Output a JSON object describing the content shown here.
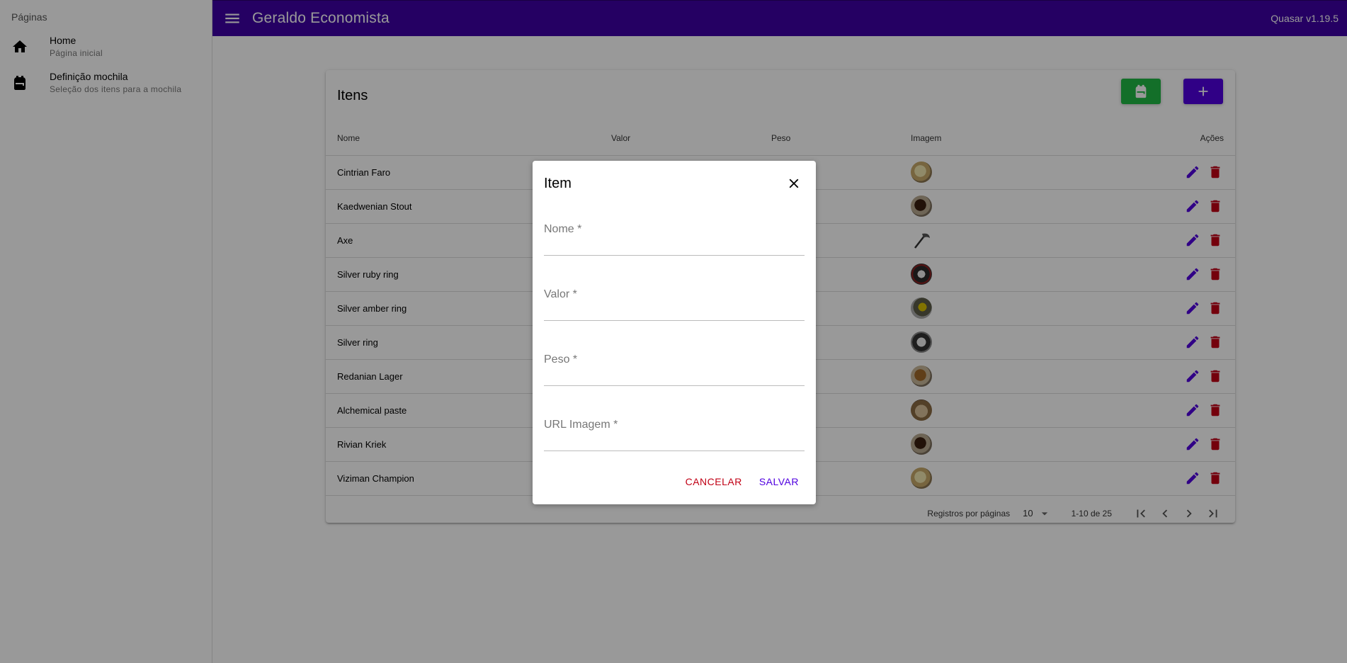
{
  "header": {
    "title": "Geraldo Economista",
    "version": "Quasar v1.19.5"
  },
  "sidebar": {
    "heading": "Páginas",
    "items": [
      {
        "label": "Home",
        "caption": "Página inicial",
        "icon": "home-icon"
      },
      {
        "label": "Definição mochila",
        "caption": "Seleção dos itens para a mochila",
        "icon": "backpack-icon"
      }
    ]
  },
  "card": {
    "title": "Itens",
    "columns": [
      "Nome",
      "Valor",
      "Peso",
      "Imagem",
      "Ações"
    ],
    "rows": [
      {
        "nome": "Cintrian Faro",
        "image": "mug-light"
      },
      {
        "nome": "Kaedwenian Stout",
        "image": "mug-dark"
      },
      {
        "nome": "Axe",
        "image": "axe"
      },
      {
        "nome": "Silver ruby ring",
        "image": "ring-ruby"
      },
      {
        "nome": "Silver amber ring",
        "image": "ring-amber"
      },
      {
        "nome": "Silver ring",
        "image": "ring-silver"
      },
      {
        "nome": "Redanian Lager",
        "image": "mug-amber"
      },
      {
        "nome": "Alchemical paste",
        "image": "pot"
      },
      {
        "nome": "Rivian Kriek",
        "image": "mug-dark"
      },
      {
        "nome": "Viziman Champion",
        "image": "mug-light"
      }
    ],
    "pagination": {
      "rows_label": "Registros por páginas",
      "rows_per_page": "10",
      "range": "1-10 de 25"
    }
  },
  "dialog": {
    "title": "Item",
    "fields": [
      {
        "label": "Nome *",
        "value": ""
      },
      {
        "label": "Valor *",
        "value": ""
      },
      {
        "label": "Peso *",
        "value": ""
      },
      {
        "label": "URL Imagem *",
        "value": ""
      }
    ],
    "cancel_label": "CANCELAR",
    "save_label": "SALVAR"
  },
  "colors": {
    "primary": "#3f00a5",
    "accent": "#5000e0",
    "positive": "#21ba45",
    "negative": "#c10015"
  }
}
